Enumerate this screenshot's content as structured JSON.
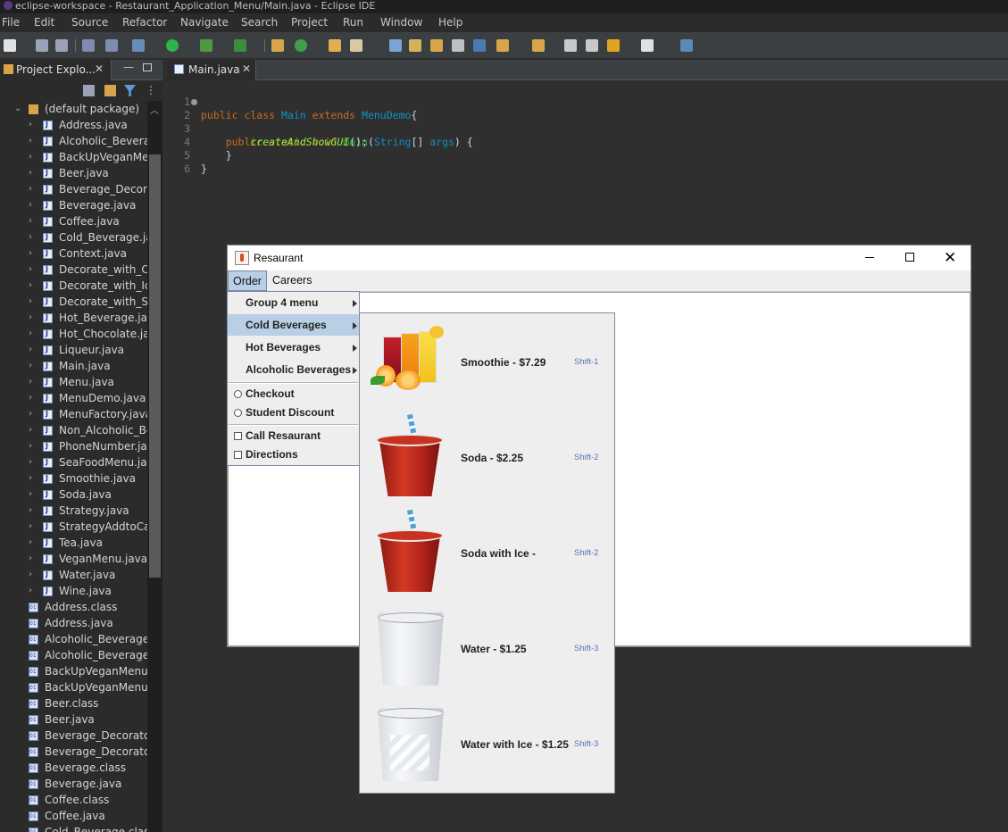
{
  "titlebar": {
    "text": "eclipse-workspace - Restaurant_Application_Menu/Main.java - Eclipse IDE"
  },
  "menubar": [
    "File",
    "Edit",
    "Source",
    "Refactor",
    "Navigate",
    "Search",
    "Project",
    "Run",
    "Window",
    "Help"
  ],
  "explorer": {
    "tab_label": "Project Explo...",
    "items": [
      {
        "label": "(default package)",
        "kind": "package",
        "expanded": true
      },
      {
        "label": "Address.java",
        "kind": "java"
      },
      {
        "label": "Alcoholic_Beverag",
        "kind": "java"
      },
      {
        "label": "BackUpVeganMen",
        "kind": "java"
      },
      {
        "label": "Beer.java",
        "kind": "java"
      },
      {
        "label": "Beverage_Decorat",
        "kind": "java"
      },
      {
        "label": "Beverage.java",
        "kind": "java"
      },
      {
        "label": "Coffee.java",
        "kind": "java"
      },
      {
        "label": "Cold_Beverage.jav",
        "kind": "java"
      },
      {
        "label": "Context.java",
        "kind": "java"
      },
      {
        "label": "Decorate_with_Cre",
        "kind": "java"
      },
      {
        "label": "Decorate_with_Ice.",
        "kind": "java"
      },
      {
        "label": "Decorate_with_Sug",
        "kind": "java"
      },
      {
        "label": "Hot_Beverage.java",
        "kind": "java"
      },
      {
        "label": "Hot_Chocolate.jav",
        "kind": "java"
      },
      {
        "label": "Liqueur.java",
        "kind": "java"
      },
      {
        "label": "Main.java",
        "kind": "java"
      },
      {
        "label": "Menu.java",
        "kind": "java"
      },
      {
        "label": "MenuDemo.java",
        "kind": "java"
      },
      {
        "label": "MenuFactory.java",
        "kind": "java"
      },
      {
        "label": "Non_Alcoholic_Bev",
        "kind": "java"
      },
      {
        "label": "PhoneNumber.java",
        "kind": "java"
      },
      {
        "label": "SeaFoodMenu.java",
        "kind": "java"
      },
      {
        "label": "Smoothie.java",
        "kind": "java"
      },
      {
        "label": "Soda.java",
        "kind": "java"
      },
      {
        "label": "Strategy.java",
        "kind": "java"
      },
      {
        "label": "StrategyAddtoCart",
        "kind": "java"
      },
      {
        "label": "Tea.java",
        "kind": "java"
      },
      {
        "label": "VeganMenu.java",
        "kind": "java"
      },
      {
        "label": "Water.java",
        "kind": "java"
      },
      {
        "label": "Wine.java",
        "kind": "java"
      },
      {
        "label": "Address.class",
        "kind": "class"
      },
      {
        "label": "Address.java",
        "kind": "class"
      },
      {
        "label": "Alcoholic_Beverage.cl",
        "kind": "class"
      },
      {
        "label": "Alcoholic_Beverage.ja",
        "kind": "class"
      },
      {
        "label": "BackUpVeganMenu.cl",
        "kind": "class"
      },
      {
        "label": "BackUpVeganMenu.ja",
        "kind": "class"
      },
      {
        "label": "Beer.class",
        "kind": "class"
      },
      {
        "label": "Beer.java",
        "kind": "class"
      },
      {
        "label": "Beverage_Decorator.c",
        "kind": "class"
      },
      {
        "label": "Beverage_Decorator.ja",
        "kind": "class"
      },
      {
        "label": "Beverage.class",
        "kind": "class"
      },
      {
        "label": "Beverage.java",
        "kind": "class"
      },
      {
        "label": "Coffee.class",
        "kind": "class"
      },
      {
        "label": "Coffee.java",
        "kind": "class"
      },
      {
        "label": "Cold_Beverage.class",
        "kind": "class"
      }
    ]
  },
  "editor": {
    "tab_label": "Main.java",
    "lines": [
      {
        "n": "1"
      },
      {
        "n": "2"
      },
      {
        "n": "3"
      },
      {
        "n": "4"
      },
      {
        "n": "5"
      },
      {
        "n": "6"
      }
    ],
    "code": {
      "public_class": "public class ",
      "main_name": "Main",
      "extends": " extends ",
      "parent": "MenuDemo",
      "brace": "{",
      "method_sig": "    public static void ",
      "method_name": "main",
      "param_open": "(",
      "param_type": "String",
      "param_rest": "[] ",
      "param_name": "args",
      "param_close": ") {",
      "call_indent": "        ",
      "call_name": "createAndShowGUI",
      "call_end": "();",
      "close_method": "    }",
      "close_class": "}"
    }
  },
  "swing": {
    "title": "Resaurant",
    "menus": [
      "Order",
      "Careers"
    ],
    "order_menu": {
      "submenus": [
        "Group 4 menu",
        "Cold Beverages",
        "Hot Beverages",
        "Alcoholic Beverages"
      ],
      "radios": [
        "Checkout",
        "Student Discount"
      ],
      "checks": [
        "Call Resaurant",
        "Directions"
      ]
    },
    "cold_beverages": [
      {
        "name": "Smoothie - $7.29",
        "accel": "Shift-1",
        "icon": "smoothie-image"
      },
      {
        "name": "Soda - $2.25",
        "accel": "Shift-2",
        "icon": "soda-cup-image"
      },
      {
        "name": "Soda with Ice - ",
        "accel": "Shift-2",
        "icon": "soda-cup-image"
      },
      {
        "name": "Water - $1.25",
        "accel": "Shift-3",
        "icon": "water-glass-image"
      },
      {
        "name": "Water with Ice - $1.25",
        "accel": "Shift-3",
        "icon": "ice-water-glass-image"
      }
    ]
  },
  "colors": {
    "eclipse_bg": "#2f2f2f",
    "menu_selection": "#b8cfe5",
    "accelerator": "#5575b5"
  }
}
